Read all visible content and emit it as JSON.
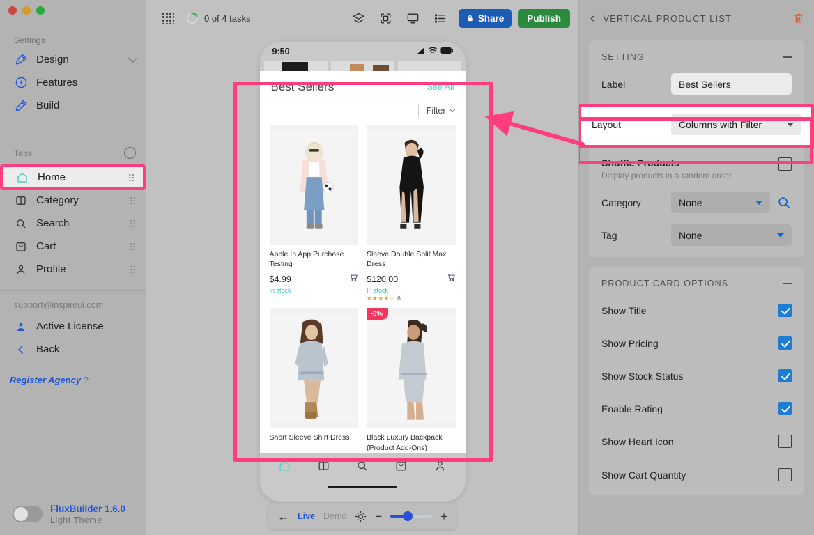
{
  "window": {
    "traffic_lights": [
      "close",
      "minimize",
      "zoom"
    ]
  },
  "sidebar": {
    "settings_label": "Settings",
    "settings_items": [
      {
        "label": "Design",
        "icon": "design-brush-icon",
        "has_chevron": true
      },
      {
        "label": "Features",
        "icon": "features-bolt-icon",
        "has_chevron": false
      },
      {
        "label": "Build",
        "icon": "build-hammer-icon",
        "has_chevron": false
      }
    ],
    "tabs_label": "Tabs",
    "add_tab_icon": "plus-circle-icon",
    "tabs": [
      {
        "label": "Home",
        "icon": "home-icon",
        "selected": true
      },
      {
        "label": "Category",
        "icon": "category-columns-icon",
        "selected": false
      },
      {
        "label": "Search",
        "icon": "search-icon",
        "selected": false
      },
      {
        "label": "Cart",
        "icon": "cart-bag-icon",
        "selected": false
      },
      {
        "label": "Profile",
        "icon": "person-icon",
        "selected": false
      }
    ],
    "support_email": "support@inspireui.com",
    "account_items": [
      {
        "label": "Active License",
        "icon": "user-license-icon"
      },
      {
        "label": "Back",
        "icon": "chevron-left-icon"
      }
    ],
    "register_agency": "Register Agency",
    "register_agency_hint": "?",
    "footer": {
      "app_name_version": "FluxBuilder 1.6.0",
      "theme": "Light Theme",
      "toggle_state": "off"
    }
  },
  "topbar": {
    "apps_icon": "apps-grid-icon",
    "task_progress": "0 of 4 tasks",
    "icons": [
      "layers-icon",
      "screenshot-frame-icon",
      "desktop-monitor-icon",
      "list-icon"
    ],
    "share_label": "Share",
    "share_icon": "lock-icon",
    "publish_label": "Publish"
  },
  "preview": {
    "statusbar": {
      "time": "9:50",
      "icons": [
        "signal-icon",
        "wifi-icon",
        "battery-icon"
      ]
    },
    "list": {
      "title": "Best Sellers",
      "see_all": "See All",
      "filter_label": "Filter",
      "filter_icon": "chevron-down-icon"
    },
    "products": [
      {
        "title": "Apple In App Purchase Testing",
        "price": "$4.99",
        "stock": "In stock",
        "cart_icon": "cart-add-icon",
        "rating_stars": "",
        "rating_count": "",
        "badge": ""
      },
      {
        "title": "Sleeve Double Split Maxi Dress",
        "price": "$120.00",
        "stock": "In stock",
        "cart_icon": "cart-add-icon",
        "rating_stars": "★★★★☆",
        "rating_count": "6",
        "badge": ""
      },
      {
        "title": "Short Sleeve Shirt Dress",
        "price": "",
        "stock": "",
        "cart_icon": "",
        "rating_stars": "",
        "rating_count": "",
        "badge": ""
      },
      {
        "title": "Black Luxury Backpack (Product Add-Ons)",
        "price": "",
        "stock": "",
        "cart_icon": "",
        "rating_stars": "",
        "rating_count": "",
        "badge": "-8%"
      }
    ],
    "bottom_nav": [
      "home-icon",
      "category-columns-icon",
      "search-icon",
      "cart-bag-icon",
      "person-icon"
    ]
  },
  "floatbar": {
    "back_icon": "arrow-left-icon",
    "live_label": "Live",
    "demo_label": "Demo",
    "brightness_icon": "brightness-icon",
    "minus_label": "−",
    "plus_label": "+",
    "slider_value": 42
  },
  "rightpanel": {
    "back_icon": "chevron-left-icon",
    "title": "VERTICAL PRODUCT LIST",
    "delete_icon": "trash-icon",
    "setting": {
      "section_title": "SETTING",
      "collapse_icon": "minus-icon",
      "label_field_label": "Label",
      "label_field_value": "Best Sellers",
      "layout_label": "Layout",
      "layout_value": "Columns with Filter",
      "layout_dropdown_icon": "chevron-down-icon",
      "shuffle_title": "Shuffle Products",
      "shuffle_sub": "Display products in a random order",
      "shuffle_checked": false,
      "category_label": "Category",
      "category_value": "None",
      "category_search_icon": "search-icon",
      "tag_label": "Tag",
      "tag_value": "None"
    },
    "product_card_options": {
      "section_title": "PRODUCT CARD OPTIONS",
      "collapse_icon": "minus-icon",
      "options": [
        {
          "label": "Show Title",
          "checked": true
        },
        {
          "label": "Show Pricing",
          "checked": true
        },
        {
          "label": "Show Stock Status",
          "checked": true
        },
        {
          "label": "Enable Rating",
          "checked": true
        },
        {
          "label": "Show Heart Icon",
          "checked": false
        },
        {
          "label": "Show Cart Quantity",
          "checked": false
        }
      ]
    }
  },
  "annotations": {
    "highlight_color": "#ff3d7f",
    "arrow": "pointer-arrow-to-preview"
  },
  "colors": {
    "accent_blue": "#2157d6",
    "share_blue": "#1c5cb4",
    "publish_green": "#2b8a3e",
    "teal": "#4dd0c5",
    "badge_red": "#f5365c",
    "checkbox_blue": "#1e7cd4"
  }
}
